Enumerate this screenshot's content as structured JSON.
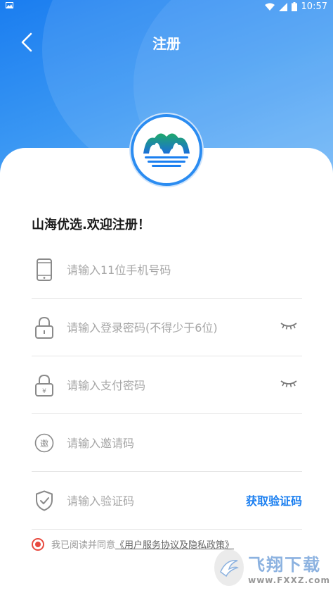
{
  "status_bar": {
    "time": "10:57",
    "notification_icon": "image-icon"
  },
  "nav": {
    "title": "注册",
    "back_icon": "chevron-left-icon"
  },
  "welcome_text": "山海优选.欢迎注册！",
  "form": {
    "phone_placeholder": "请输入11位手机号码",
    "login_password_placeholder": "请输入登录密码(不得少于6位)",
    "pay_password_placeholder": "请输入支付密码",
    "invite_code_placeholder": "请输入邀请码",
    "verify_code_placeholder": "请输入验证码",
    "get_code_label": "获取验证码",
    "invite_icon_char": "邀"
  },
  "agreement": {
    "prefix": "我已阅读并同意",
    "link": "《用户服务协议及隐私政策》",
    "checked": true
  },
  "watermark": {
    "cn": "飞翔下载",
    "url": "www.FXXZ.com"
  },
  "colors": {
    "header_blue": "#1a7df0",
    "accent_blue": "#1b7ff0",
    "agree_red": "#e84a3f"
  }
}
